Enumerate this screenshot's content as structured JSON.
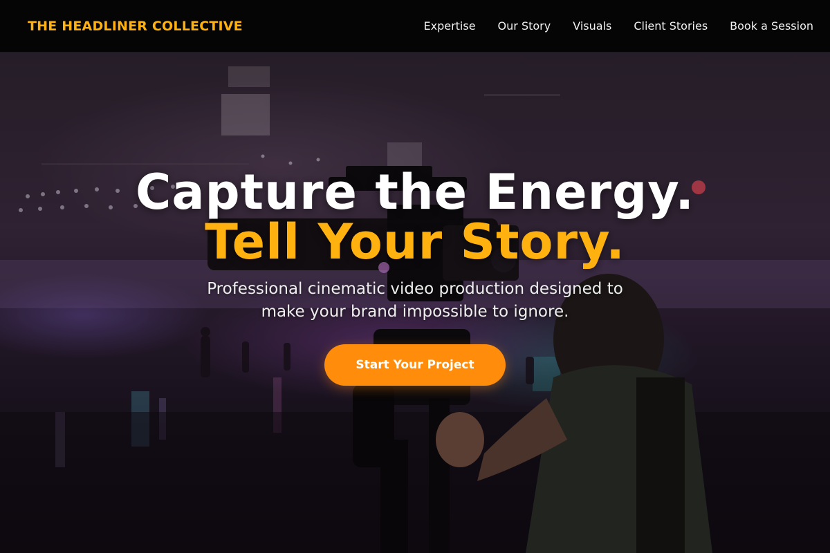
{
  "header": {
    "brand": "THE HEADLINER COLLECTIVE",
    "nav": [
      {
        "label": "Expertise"
      },
      {
        "label": "Our Story"
      },
      {
        "label": "Visuals"
      },
      {
        "label": "Client Stories"
      },
      {
        "label": "Book a Session"
      }
    ]
  },
  "hero": {
    "headline_line1": "Capture the Energy.",
    "headline_line2": "Tell Your Story.",
    "subtitle": "Professional cinematic video production designed to make your brand impossible to ignore.",
    "cta_label": "Start Your Project",
    "background_description": "Videographer operating a cinema camera rig in a dim roller-rink hall with purple and teal lights"
  },
  "colors": {
    "accent": "#ffb20f",
    "cta": "#ff8c0a",
    "header_bg": "#050505"
  }
}
